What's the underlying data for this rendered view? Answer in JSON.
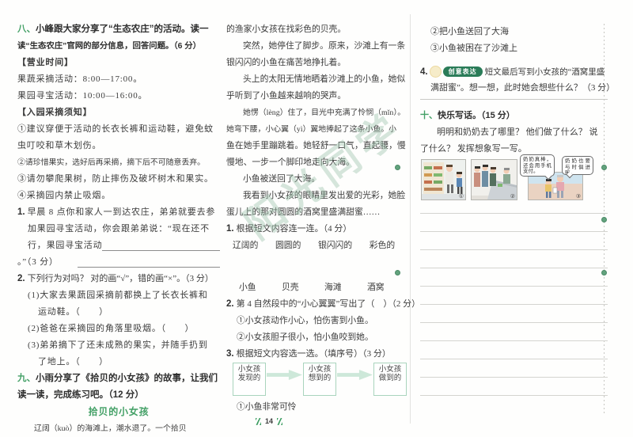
{
  "page": {
    "watermark": "阳光同学",
    "footer_page_number": "14",
    "accent_green": "#43a066",
    "badge_green": "#2a7c58"
  },
  "left_page": {
    "col1_lines": [
      {
        "num": "八、",
        "text": "小峰跟大家分享了“生态农庄”的活动。读一",
        "cls": "h"
      },
      {
        "text": "读“生态农庄”官网的部分信息，回答问题。（6 分）",
        "cls": "h hsm"
      },
      {
        "text": "【营业时间】",
        "cls": "brk"
      },
      {
        "text": "果蔬采摘活动：8:00—17:00。",
        "cls": ""
      },
      {
        "text": "果园寻宝活动：10:00—16:00。",
        "cls": ""
      },
      {
        "text": "【入园采摘须知】",
        "cls": "brk"
      },
      {
        "text": "①建议穿便于活动的长衣长裤和运动鞋，避免蚊",
        "cls": ""
      },
      {
        "text": "虫叮咬和草木划伤。",
        "cls": ""
      },
      {
        "text": "②请珍惜果实，选好后再采摘，摘下后不可随意丢弃。",
        "cls": "tight"
      },
      {
        "text": "③请勿攀爬果树，防止摔伤及破坏树木和果实。",
        "cls": ""
      },
      {
        "text": "④采摘园内禁止吸烟。",
        "cls": ""
      },
      {
        "num": "1.",
        "text": "早晨 8 点你和家人一到达农庄，弟弟就要去参",
        "cls": "q"
      },
      {
        "text": "加果园寻宝活动，你会跟弟弟说：“现在还不",
        "cls": "ind1"
      },
      {
        "text": "行，果园寻宝活动",
        "cls": "ind1 fa"
      },
      {
        "text": "。”（3 分）",
        "cls": "fb"
      },
      {
        "num": "2.",
        "text": "下列行为对吗？ 对的画“√”，错的画“×”。（3 分）",
        "cls": "q tight"
      },
      {
        "text": "(1)大家去果蔬园采摘前都换上了长衣长裤和",
        "cls": "ind1"
      },
      {
        "text": "运动鞋。（　　）",
        "cls": "ind2"
      },
      {
        "text": "(2)爸爸在采摘园的角落里吸烟。（　　）",
        "cls": "ind1"
      },
      {
        "text": "(3)弟弟摘下了还未成熟的果实，并随手扔到",
        "cls": "ind1"
      },
      {
        "text": "了地上。（　　）",
        "cls": "ind2"
      },
      {
        "num": "九、",
        "text": "小雨分享了《拾贝的小女孩》的故事，让我们",
        "cls": "h"
      },
      {
        "text": "读一读，完成练习吧。（12 分）",
        "cls": "h"
      },
      {
        "text": "拾贝的小女孩",
        "cls": "gtitle"
      },
      {
        "text": "辽阔（kuò）的海滩上，潮水退了。一个拾贝",
        "cls": "pind tight"
      }
    ],
    "col2_lines_top": [
      {
        "text": "的渔家小女孩在找彩色的贝壳。",
        "cls": ""
      },
      {
        "text": "突然，她停住了脚步。原来，沙滩上有一条",
        "cls": "pind"
      },
      {
        "text": "银闪闪的小鱼在痛苦地挣扎着。",
        "cls": ""
      },
      {
        "text": "头上的太阳无情地晒着沙滩上的小鱼，她似",
        "cls": "pind"
      },
      {
        "text": "乎听到了小鱼越来越响的哭声。",
        "cls": ""
      },
      {
        "text": "她愣（lèng）住了，目光中充满了怜悯（mǐn）。",
        "cls": "pind tight"
      },
      {
        "text": "她弯下腰，小心翼（yì）翼地捧起了这条小鱼。小",
        "cls": "tight"
      },
      {
        "text": "鱼在她手里蹦跳着。她轻舒一口气，直起腰，慢",
        "cls": ""
      },
      {
        "text": "慢地、一步一个脚印地走向大海。",
        "cls": ""
      },
      {
        "text": "小鱼被送回了大海。",
        "cls": "pind"
      },
      {
        "text": "我看到小女孩的眼睛里发出爱的光彩，她脸",
        "cls": "pind"
      },
      {
        "text": "蛋儿上的那对圆圆的酒窝里盛满甜蜜……",
        "cls": ""
      },
      {
        "num": "1.",
        "text": "根据短文内容连一连。（4 分）",
        "cls": "q"
      },
      {
        "text": "辽阔的　　圆圆的　　银闪闪的　　彩色的",
        "cls": "crow"
      },
      {
        "text": "",
        "cls": "spacer"
      },
      {
        "text": "小鱼　　　贝壳　　　海滩　　　酒窝",
        "cls": "crow2"
      },
      {
        "num": "2.",
        "text": "第 4 自然段中的“小心翼翼”写出了（　）（2 分）",
        "cls": "q tight2"
      },
      {
        "text": "①小女孩动作小心，怕伤害到小鱼。",
        "cls": "ind1"
      },
      {
        "text": "②小女孩胆子很小，怕小鱼咬到她。",
        "cls": "ind1"
      },
      {
        "num": "3.",
        "text": "根据短文内容选一选。（填序号）（3 分）",
        "cls": "q"
      }
    ],
    "q3_flow_boxes": [
      {
        "label": "小女孩\n发现的"
      },
      {
        "label": "小女孩\n想到的"
      },
      {
        "label": "小女孩\n做到的"
      }
    ],
    "col2_lines_bottom": [
      {
        "text": "①小鱼非常可怜",
        "cls": "ind1"
      }
    ]
  },
  "right_page": {
    "col3_options": [
      {
        "text": "②把小鱼送回了大海",
        "cls": "ind1"
      },
      {
        "text": "③小鱼被困在了沙滩上",
        "cls": "ind1"
      }
    ],
    "q4": {
      "num": "4.",
      "badge": "创意表达",
      "line1": "短文最后写到小女孩的“酒窝里盛",
      "line2": "满甜蜜”。想一想，此时她会想些什么？（3 分）"
    },
    "section_ten": {
      "num": "十、",
      "title": "快乐写话。（15 分）",
      "para_lines": [
        {
          "text": "明明和奶奶去了哪里？ 他们做了什么？ 说",
          "cls": "pind"
        },
        {
          "text": "了什么？ 发挥想象写一写。",
          "cls": ""
        }
      ]
    },
    "panels": {
      "bubble1": "奶奶真棒，还会用手机支付。",
      "bubble2": "奶奶也要与时俱进嘛。",
      "panel_numbers": [
        "①",
        "②",
        "③"
      ]
    }
  }
}
